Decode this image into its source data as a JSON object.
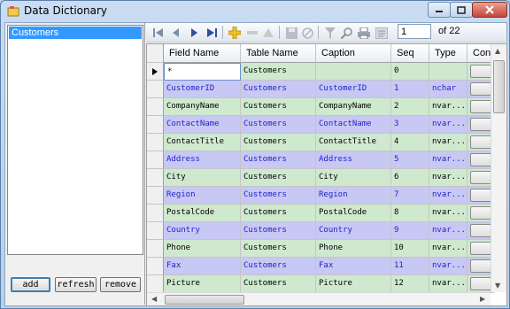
{
  "window": {
    "title": "Data Dictionary",
    "app_icon": "database-icon"
  },
  "left": {
    "list_items": [
      "Customers"
    ],
    "buttons": {
      "add": "add",
      "refresh": "refresh",
      "remove": "remove"
    }
  },
  "navigator": {
    "position": "1",
    "count_label": "of 22",
    "icons": [
      "move-first-icon",
      "move-previous-icon",
      "move-next-icon",
      "move-last-icon",
      "add-new-icon",
      "delete-icon",
      "move-up-icon",
      "save-icon",
      "cancel-icon",
      "filter-icon",
      "search-icon",
      "print-icon",
      "export-icon"
    ]
  },
  "grid": {
    "columns": [
      "Field Name",
      "Table Name",
      "Caption",
      "Seq",
      "Type",
      "Contr"
    ],
    "rows": [
      {
        "style": "green",
        "field": "*",
        "table": "Customers",
        "caption": "",
        "seq": "0",
        "type": ""
      },
      {
        "style": "blue",
        "field": "CustomerID",
        "table": "Customers",
        "caption": "CustomerID",
        "seq": "1",
        "type": "nchar"
      },
      {
        "style": "green",
        "field": "CompanyName",
        "table": "Customers",
        "caption": "CompanyName",
        "seq": "2",
        "type": "nvar..."
      },
      {
        "style": "blue",
        "field": "ContactName",
        "table": "Customers",
        "caption": "ContactName",
        "seq": "3",
        "type": "nvar..."
      },
      {
        "style": "green",
        "field": "ContactTitle",
        "table": "Customers",
        "caption": "ContactTitle",
        "seq": "4",
        "type": "nvar..."
      },
      {
        "style": "blue",
        "field": "Address",
        "table": "Customers",
        "caption": "Address",
        "seq": "5",
        "type": "nvar..."
      },
      {
        "style": "green",
        "field": "City",
        "table": "Customers",
        "caption": "City",
        "seq": "6",
        "type": "nvar..."
      },
      {
        "style": "blue",
        "field": "Region",
        "table": "Customers",
        "caption": "Region",
        "seq": "7",
        "type": "nvar..."
      },
      {
        "style": "green",
        "field": "PostalCode",
        "table": "Customers",
        "caption": "PostalCode",
        "seq": "8",
        "type": "nvar..."
      },
      {
        "style": "blue",
        "field": "Country",
        "table": "Customers",
        "caption": "Country",
        "seq": "9",
        "type": "nvar..."
      },
      {
        "style": "green",
        "field": "Phone",
        "table": "Customers",
        "caption": "Phone",
        "seq": "10",
        "type": "nvar..."
      },
      {
        "style": "blue",
        "field": "Fax",
        "table": "Customers",
        "caption": "Fax",
        "seq": "11",
        "type": "nvar..."
      },
      {
        "style": "green",
        "field": "Picture",
        "table": "Customers",
        "caption": "Picture",
        "seq": "12",
        "type": "nvar..."
      }
    ]
  },
  "colors": {
    "row_green": "#cfe9cf",
    "row_blue": "#c8c8f4",
    "blue_text": "#2222cc",
    "selection": "#3399ff"
  }
}
